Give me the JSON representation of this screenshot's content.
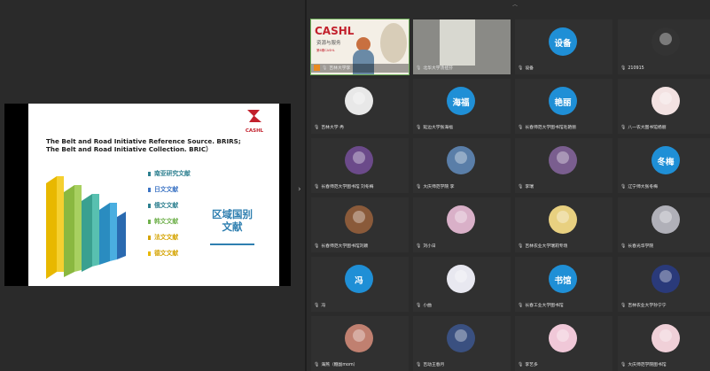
{
  "slide": {
    "title_line1": "The Belt and Road Initiative Reference Source. BRIRS;",
    "title_line2": "The Belt and Road Initiative Collection. BRIC）",
    "logo_text": "CASHL",
    "list": [
      "南亚研究文献",
      "日文文献",
      "俄文文献",
      "韩文文献",
      "法文文献",
      "德文文献"
    ],
    "list_colors": [
      "#2c7f8f",
      "#6fb04c",
      "#3c74c4",
      "#d4a300",
      "#5fa0c8",
      "#e08a00"
    ],
    "region_line1": "区域国别",
    "region_line2": "文献"
  },
  "active_tile": {
    "brand": "CASHL",
    "brand_sub": "资源与服务",
    "brand_small": "第6期CASHL",
    "label": "吉林大学李"
  },
  "participants": [
    {
      "label": "北华大学汤拯芬",
      "avatar_text": "",
      "avatar_color": "#6a6a6a",
      "kind": "photo-wall"
    },
    {
      "label": "设备",
      "avatar_text": "设备",
      "avatar_color": "#1f8fd6"
    },
    {
      "label": "210915",
      "avatar_text": "",
      "avatar_color": "#333",
      "kind": "bear"
    },
    {
      "label": "吉林大学 冉",
      "avatar_text": "",
      "avatar_color": "#e8e8e8",
      "kind": "person"
    },
    {
      "label": "延边大学张海福",
      "avatar_text": "海福",
      "avatar_color": "#1f8fd6"
    },
    {
      "label": "长春师范大学图书馆毛艳丽",
      "avatar_text": "艳丽",
      "avatar_color": "#1f8fd6"
    },
    {
      "label": "八一农大图书馆杨丽",
      "avatar_text": "",
      "avatar_color": "#f3e2e2",
      "kind": "girl"
    },
    {
      "label": "长春师范大学图书馆 刘冬梅",
      "avatar_text": "",
      "avatar_color": "#6b4a8a",
      "kind": "lanterns"
    },
    {
      "label": "大庆师范学院 李",
      "avatar_text": "",
      "avatar_color": "#5a7ea8",
      "kind": "scene"
    },
    {
      "label": "李瑞",
      "avatar_text": "",
      "avatar_color": "#7a5e8f",
      "kind": "scene"
    },
    {
      "label": "辽宁师大张冬梅",
      "avatar_text": "冬梅",
      "avatar_color": "#1f8fd6"
    },
    {
      "label": "长春师范大学图书馆刘颖",
      "avatar_text": "",
      "avatar_color": "#8a5a3a",
      "kind": "sunset"
    },
    {
      "label": "刘小日",
      "avatar_text": "",
      "avatar_color": "#d9b0c8",
      "kind": "blossom"
    },
    {
      "label": "吉林农业大学瑞莉专场",
      "avatar_text": "",
      "avatar_color": "#e8d080",
      "kind": "baby"
    },
    {
      "label": "长春光华学院",
      "avatar_text": "",
      "avatar_color": "#b0b0b8",
      "kind": "tree"
    },
    {
      "label": "冯",
      "avatar_text": "冯",
      "avatar_color": "#1f8fd6"
    },
    {
      "label": "小曲",
      "avatar_text": "",
      "avatar_color": "#e8e8f0",
      "kind": "cartoon"
    },
    {
      "label": "长春工业大学图书馆",
      "avatar_text": "书馆",
      "avatar_color": "#1f8fd6"
    },
    {
      "label": "吉林农业大学孙宁宁",
      "avatar_text": "",
      "avatar_color": "#2a3a7a",
      "kind": "flower"
    },
    {
      "label": "海燕（糖副mom）",
      "avatar_text": "",
      "avatar_color": "#c08070",
      "kind": "sunset"
    },
    {
      "label": "吉动王春月",
      "avatar_text": "",
      "avatar_color": "#3a5080",
      "kind": "night"
    },
    {
      "label": "李艺多",
      "avatar_text": "",
      "avatar_color": "#f0c8d8",
      "kind": "girl"
    },
    {
      "label": "大庆师范学院图书馆",
      "avatar_text": "",
      "avatar_color": "#f0d0d8",
      "kind": "girl"
    }
  ]
}
